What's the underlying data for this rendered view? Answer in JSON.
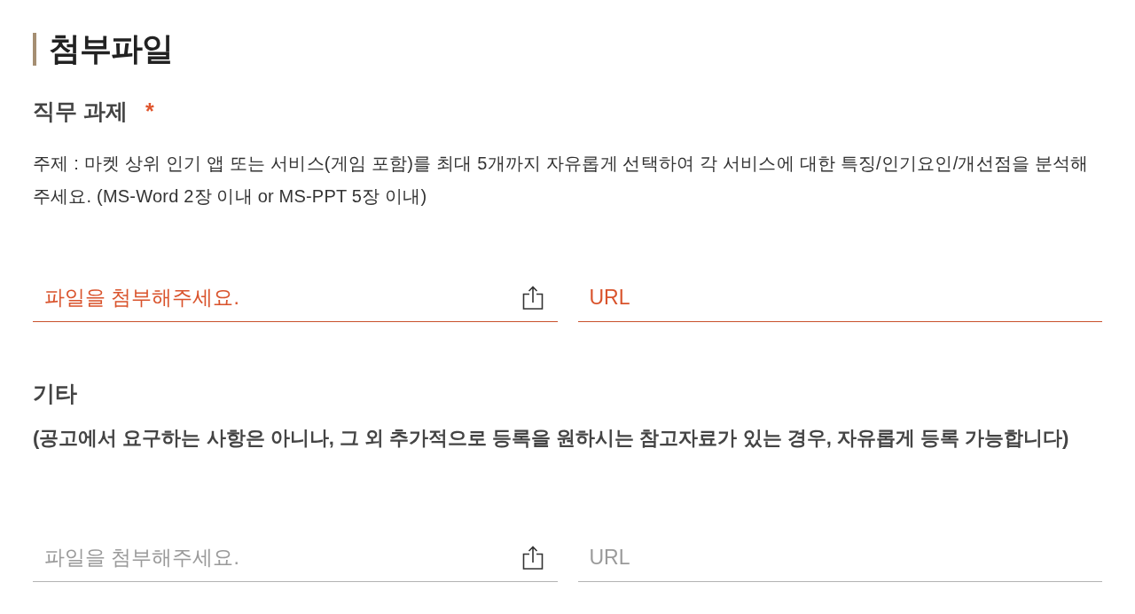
{
  "section_title": "첨부파일",
  "groups": [
    {
      "kind": "topic",
      "title": "직무 과제",
      "required": true,
      "required_mark": "*",
      "description": "주제 : 마켓 상위 인기 앱 또는 서비스(게임 포함)를 최대 5개까지 자유롭게 선택하여 각 서비스에 대한 특징/인기요인/개선점을 분석해 주세요. (MS-Word 2장 이내 or MS-PPT 5장 이내)",
      "file_field": {
        "placeholder": "파일을 첨부해주세요."
      },
      "url_field": {
        "placeholder": "URL"
      }
    },
    {
      "kind": "note",
      "title": "기타",
      "required": false,
      "description": "(공고에서 요구하는 사항은 아니나, 그 외 추가적으로 등록을 원하시는 참고자료가 있는 경우, 자유롭게 등록 가능합니다)",
      "file_field": {
        "placeholder": "파일을 첨부해주세요."
      },
      "url_field": {
        "placeholder": "URL"
      }
    }
  ]
}
